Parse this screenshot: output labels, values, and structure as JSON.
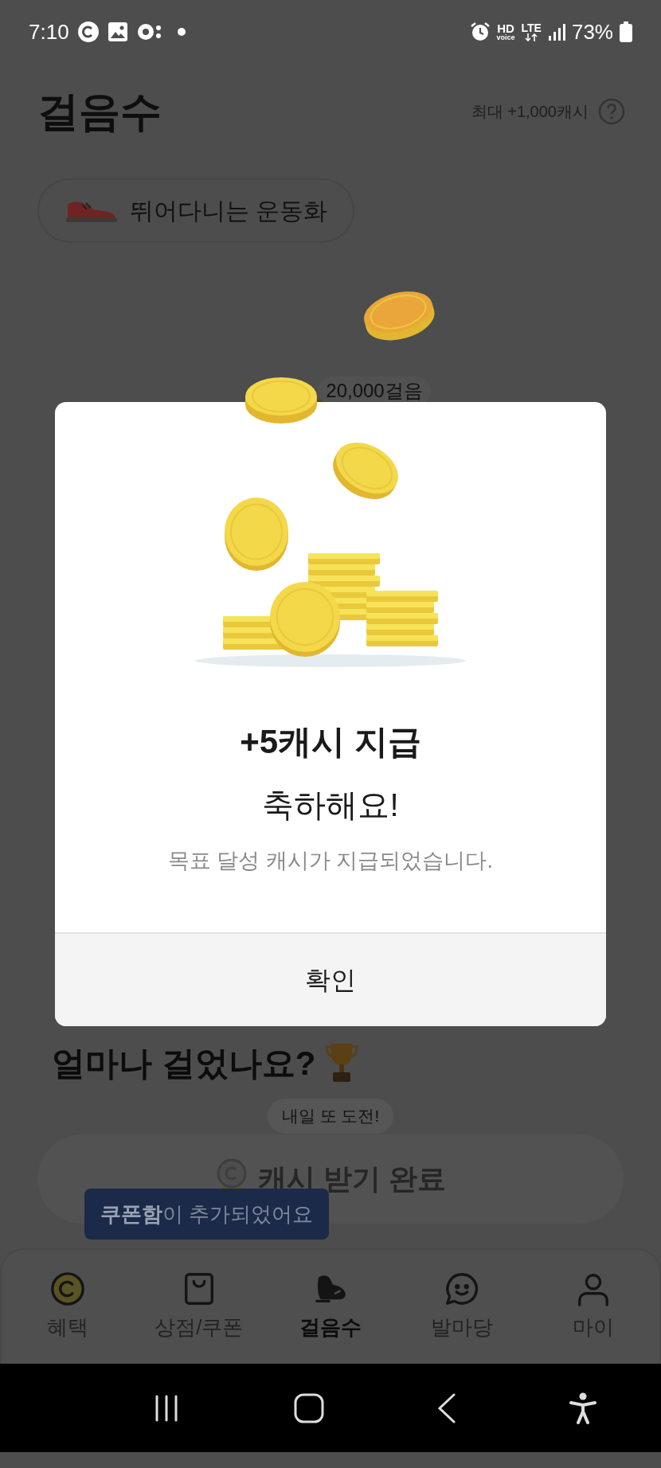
{
  "status_bar": {
    "time": "7:10",
    "hd": "HD",
    "voice": "voice",
    "network": "LTE",
    "battery": "73%"
  },
  "header": {
    "title": "걸음수",
    "max_reward": "최대 +1,000캐시"
  },
  "shoe_chip": {
    "label": "뛰어다니는 운동화"
  },
  "ring": {
    "goal_label": "20,000걸음"
  },
  "dialog": {
    "title": "+5캐시 지급",
    "message": "축하해요!",
    "description": "목표 달성 캐시가 지급되었습니다.",
    "button": "확인"
  },
  "section": {
    "heading": "얼마나 걸었나요?"
  },
  "claim": {
    "tooltip": "내일 또 도전!",
    "label": "캐시 받기 완료",
    "disabled": true
  },
  "toast": {
    "text": "**쿠폰함**이 추가되었어요"
  },
  "nav": [
    {
      "kind": "coin",
      "label": "혜택",
      "selected": false
    },
    {
      "kind": "bag",
      "label": "상점/쿠폰",
      "selected": false
    },
    {
      "kind": "shoe",
      "label": "걸음수",
      "selected": true
    },
    {
      "kind": "chat",
      "label": "발마당",
      "selected": false
    },
    {
      "kind": "person",
      "label": "마이",
      "selected": false
    }
  ]
}
